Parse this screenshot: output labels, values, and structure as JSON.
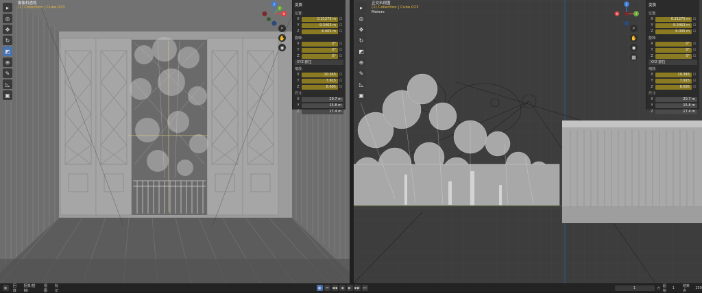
{
  "left_viewport": {
    "title": "摄像机透视",
    "collection": "(1) Collection | Cube.023"
  },
  "right_viewport": {
    "title": "正交右视图",
    "collection": "(1) Collection | Cube.023",
    "units": "Meters"
  },
  "gizmo": {
    "x": "X",
    "y": "Y",
    "z": "Z"
  },
  "n_panel": {
    "header": "变换",
    "location_label": "位置:",
    "location": {
      "x": "0.21275 m",
      "y": "-9.3463 m",
      "z": "6.005 m"
    },
    "rotation_label": "旋转:",
    "rotation": {
      "x": "0°",
      "y": "0°",
      "z": "0°"
    },
    "rotation_mode": "XYZ 欧拉",
    "scale_label": "缩放:",
    "scale": {
      "x": "10.345",
      "y": "7.915",
      "z": "8.695"
    },
    "dimensions_label": "尺寸:",
    "dimensions": {
      "x": "20.7 m",
      "y": "15.8 m",
      "z": "17.4 m"
    }
  },
  "status_bar": {
    "menu_1": "回放",
    "menu_2": "抠像(插帧)",
    "menu_3": "视图",
    "menu_4": "标记",
    "current_frame": "1",
    "start_label": "起始",
    "start_value": "1",
    "end_label": "结束点",
    "end_value": "250"
  },
  "icons": {
    "cursor": "cursor-icon",
    "move": "move-icon",
    "rotate": "rotate-icon",
    "scale": "scale-icon",
    "transform": "transform-icon",
    "annotate": "annotate-icon",
    "measure": "measure-icon",
    "add_cube": "add-cube-icon",
    "zoom": "zoom-icon",
    "pan": "hand-icon",
    "camera": "camera-icon",
    "grid": "grid-icon"
  },
  "colors": {
    "accent": "#4772b3",
    "keyframed": "#8a7a22",
    "axis_x": "#e04040",
    "axis_y": "#6aa83a",
    "axis_z": "#3a7ad4"
  }
}
